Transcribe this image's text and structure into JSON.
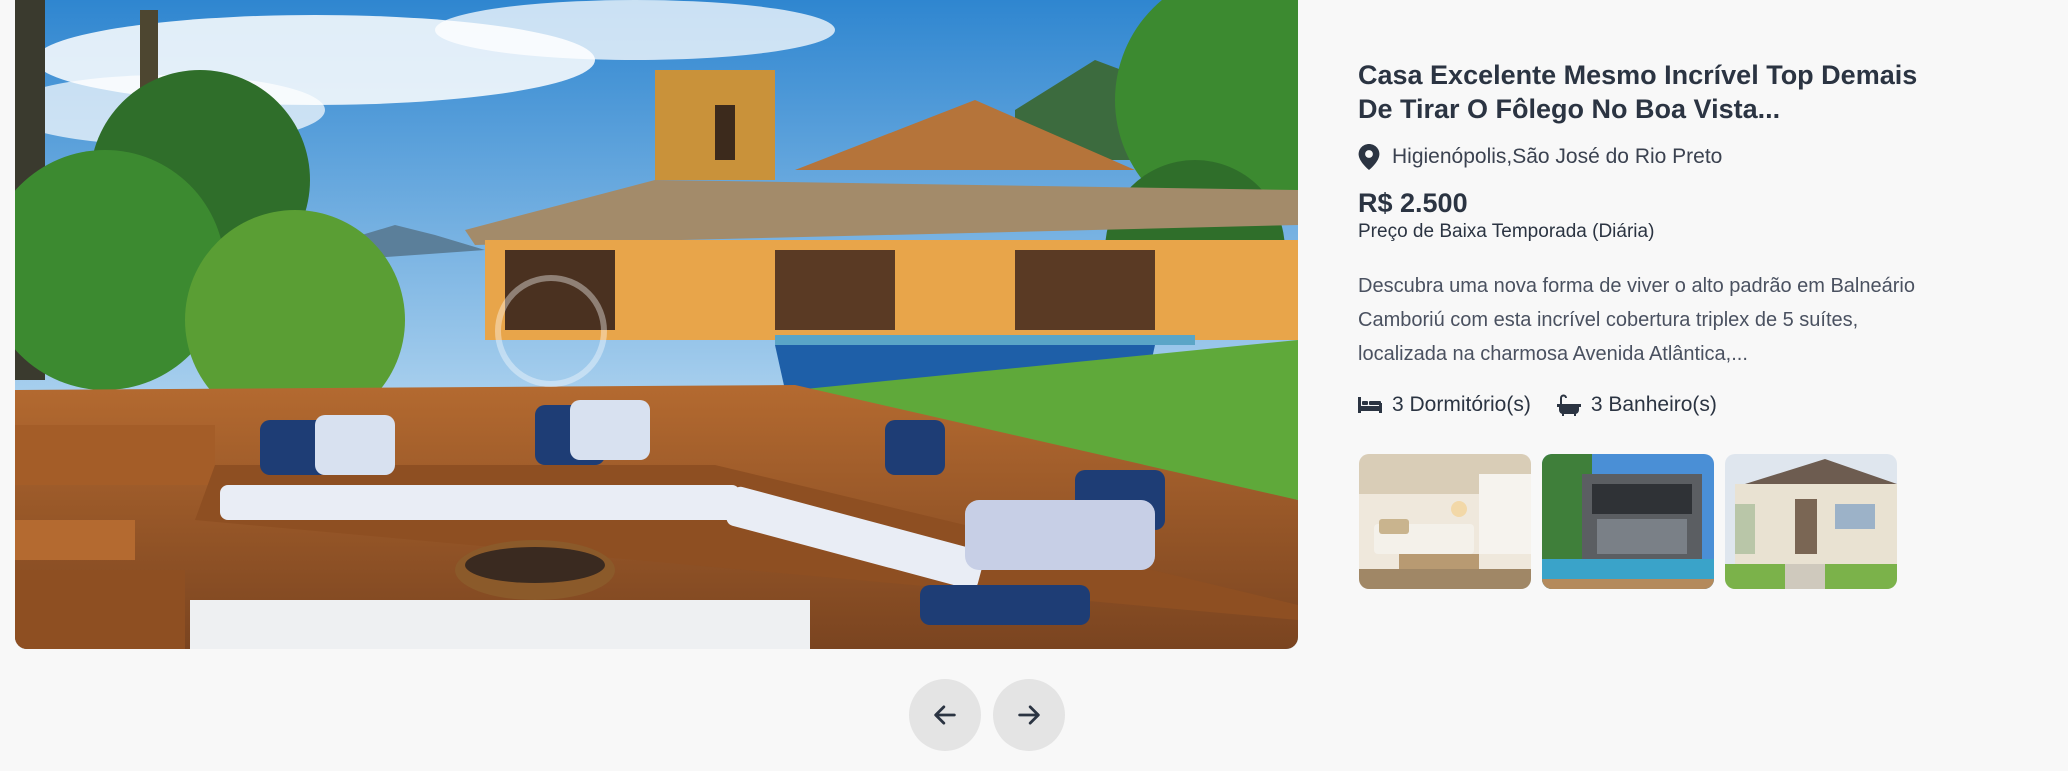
{
  "listing": {
    "title": "Casa Excelente Mesmo Incrível Top Demais De Tirar O Fôlego No Boa Vista...",
    "location": "Higienópolis,São José do Rio Preto",
    "price": "R$ 2.500",
    "price_label": "Preço de Baixa Temporada (Diária)",
    "description": "Descubra uma nova forma de viver o alto padrão em Balneário Camboriú com esta incrível cobertura triplex de 5 suítes, localizada na charmosa Avenida Atlântica,...",
    "bedrooms": "3 Dormitório(s)",
    "bathrooms": "3 Banheiro(s)"
  },
  "icons": {
    "location": "map-pin-icon",
    "bed": "bed-icon",
    "bath": "bathtub-icon",
    "prev": "arrow-left-icon",
    "next": "arrow-right-icon"
  },
  "colors": {
    "text": "#2b3442",
    "nav_button": "#e4e4e4",
    "background": "#f8f8f8"
  }
}
